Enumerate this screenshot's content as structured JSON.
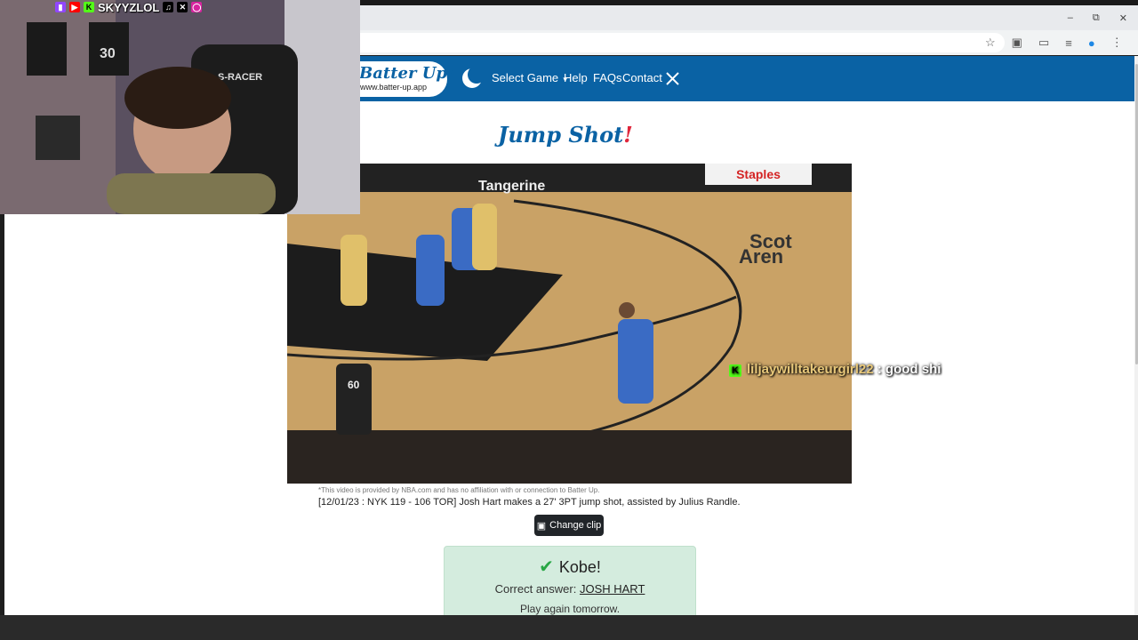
{
  "site": {
    "logo_title": "Batter Up!",
    "logo_url": "www.batter-up.app",
    "nav": {
      "select_game": "Select Game",
      "help": "Help",
      "faqs": "FAQs",
      "contact": "Contact"
    },
    "page_title": "Jump Shot",
    "page_title_bang": "!"
  },
  "video": {
    "disclaimer": "*This video is provided by NBA.com and has no affiliation with or connection to Batter Up.",
    "caption": "[12/01/23 : NYK 119 - 106 TOR] Josh Hart makes a 27' 3PT jump shot, assisted by Julius Randle.",
    "court_text_top": "Tangerine",
    "court_text_right_1": "Scot",
    "court_text_right_2": "Aren",
    "banner_text": "Staples",
    "referee_number": "60"
  },
  "change_clip": {
    "label": "Change clip"
  },
  "result": {
    "title": "Kobe!",
    "answer_prefix": "Correct answer:",
    "answer_name": "JOSH HART",
    "play_again": "Play again tomorrow."
  },
  "stream": {
    "handle": "SKYYZLOL",
    "chat_user": "liljaywilltakeurgirl22",
    "chat_separator": " : ",
    "chat_message": "good shi",
    "chair_brand": "S-RACER",
    "jersey_number": "30"
  },
  "colors": {
    "nav_blue": "#0a62a4",
    "title_red": "#e0263b",
    "result_green_bg": "#d4ecde",
    "check_green": "#28a745"
  }
}
